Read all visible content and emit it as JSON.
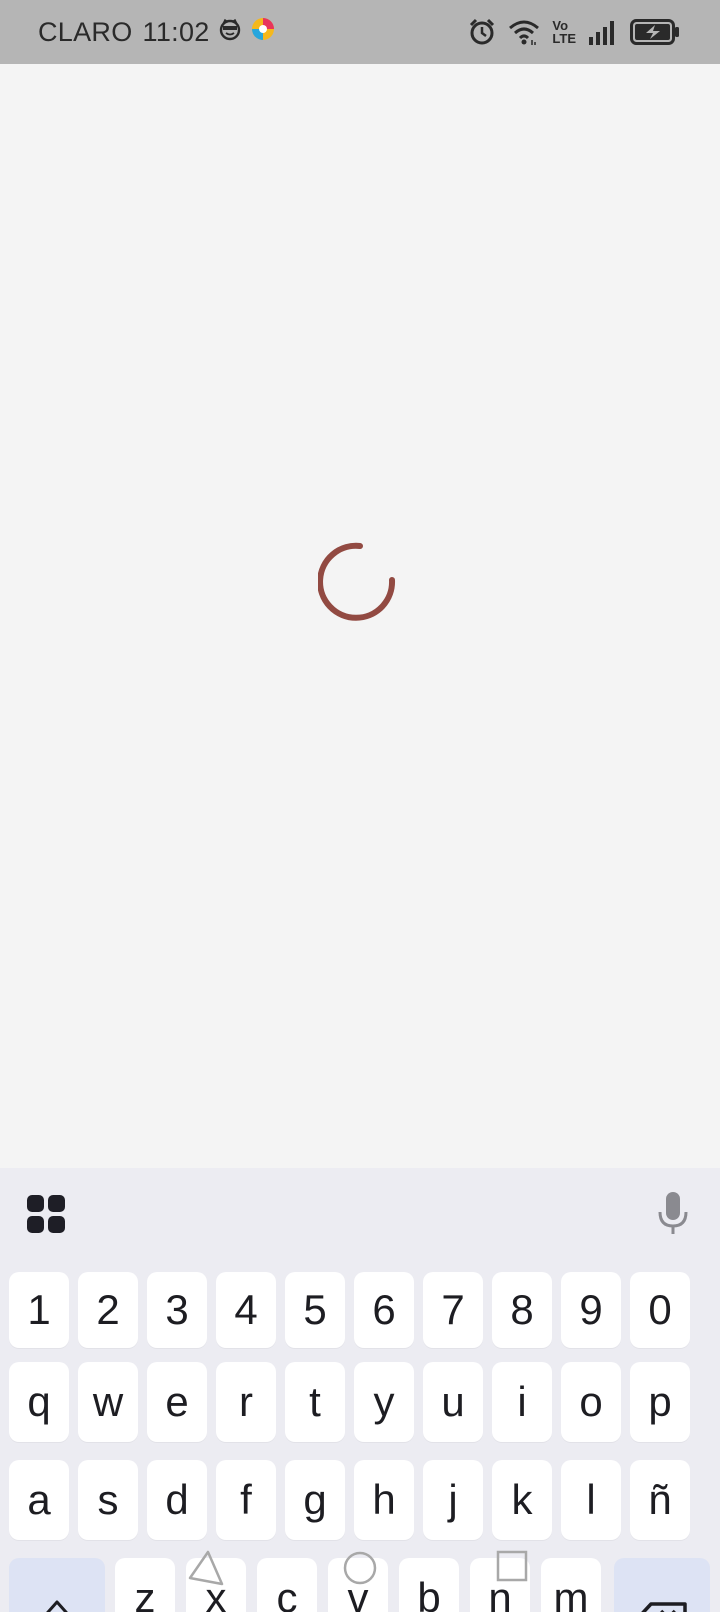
{
  "status_bar": {
    "carrier": "CLARO",
    "time": "11:02",
    "left_icons": [
      "smiley-cat-icon",
      "app-color-icon"
    ],
    "right_icons": [
      "alarm-icon",
      "wifi-icon",
      "volte-icon",
      "signal-icon",
      "battery-charging-icon"
    ],
    "volte_top": "Vo",
    "volte_bottom": "LTE"
  },
  "main": {
    "state": "loading",
    "spinner_color": "#924a42"
  },
  "keyboard": {
    "toolbar": {
      "left_icon": "apps-grid-icon",
      "right_icon": "microphone-icon"
    },
    "rows": [
      [
        "1",
        "2",
        "3",
        "4",
        "5",
        "6",
        "7",
        "8",
        "9",
        "0"
      ],
      [
        "q",
        "w",
        "e",
        "r",
        "t",
        "y",
        "u",
        "i",
        "o",
        "p"
      ],
      [
        "a",
        "s",
        "d",
        "f",
        "g",
        "h",
        "j",
        "k",
        "l",
        "ñ"
      ],
      [
        "z",
        "x",
        "c",
        "v",
        "b",
        "n",
        "m"
      ]
    ],
    "shift_icon": "shift-icon",
    "backspace_icon": "backspace-icon"
  },
  "nav_bar": {
    "buttons": [
      "back-triangle-icon",
      "home-circle-icon",
      "recents-square-icon"
    ]
  },
  "colors": {
    "status_bar_bg": "#b5b5b5",
    "background": "#f4f4f4",
    "keyboard_bg": "#ececf2",
    "special_key_bg": "#dde3f4",
    "accent": "#924a42"
  }
}
